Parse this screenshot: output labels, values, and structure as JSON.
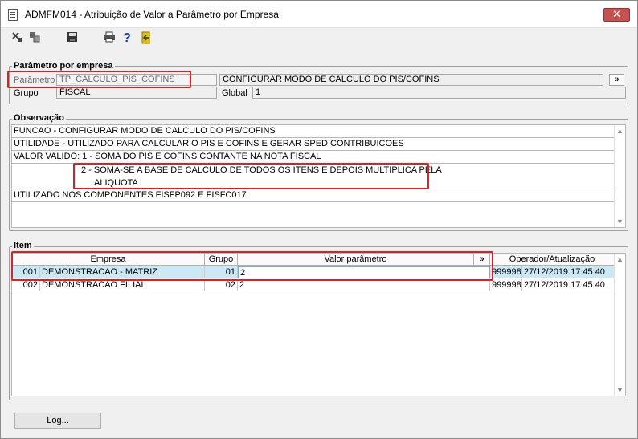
{
  "window": {
    "title": "ADMFM014 - Atribuição de Valor a Parâmetro por Empresa",
    "close_label": "✕"
  },
  "toolbar": {
    "icons": [
      "cut-icon",
      "paste-icon",
      "save-icon",
      "print-icon",
      "help-icon",
      "exit-icon"
    ]
  },
  "parametro": {
    "legend": "Parâmetro por empresa",
    "parametro_label": "Parâmetro",
    "parametro_value": "TP_CALCULO_PIS_COFINS",
    "descricao_value": "CONFIGURAR MODO DE CALCULO DO PIS/COFINS",
    "expand_label": "»",
    "grupo_label": "Grupo",
    "grupo_value": "FISCAL",
    "global_label": "Global",
    "global_value": "1"
  },
  "observacao": {
    "legend": "Observação",
    "lines": [
      "FUNCAO - CONFIGURAR MODO DE CALCULO DO PIS/COFINS",
      "UTILIDADE - UTILIZADO PARA CALCULAR O PIS E COFINS E GERAR SPED CONTRIBUICOES",
      "VALOR VALIDO: 1 - SOMA DO PIS E COFINS CONTANTE NA NOTA FISCAL",
      "2 - SOMA-SE A BASE DE CALCULO DE TODOS OS ITENS E DEPOIS MULTIPLICA PELA",
      "ALIQUOTA",
      "UTILIZADO NOS COMPONENTES FISFP092 E FISFC017"
    ]
  },
  "item": {
    "legend": "Item",
    "columns": {
      "empresa": "Empresa",
      "grupo": "Grupo",
      "valor": "Valor parâmetro",
      "expand": "»",
      "operador": "Operador/Atualização"
    },
    "rows": [
      {
        "code": "001",
        "empresa": "DEMONSTRACAO - MATRIZ",
        "grupo": "01",
        "valor": "2",
        "operador": "999998",
        "atualizacao": "27/12/2019 17:45:40"
      },
      {
        "code": "002",
        "empresa": "DEMONSTRACAO FILIAL",
        "grupo": "02",
        "valor": "2",
        "operador": "999998",
        "atualizacao": "27/12/2019 17:45:40"
      }
    ]
  },
  "footer": {
    "log_label": "Log..."
  }
}
